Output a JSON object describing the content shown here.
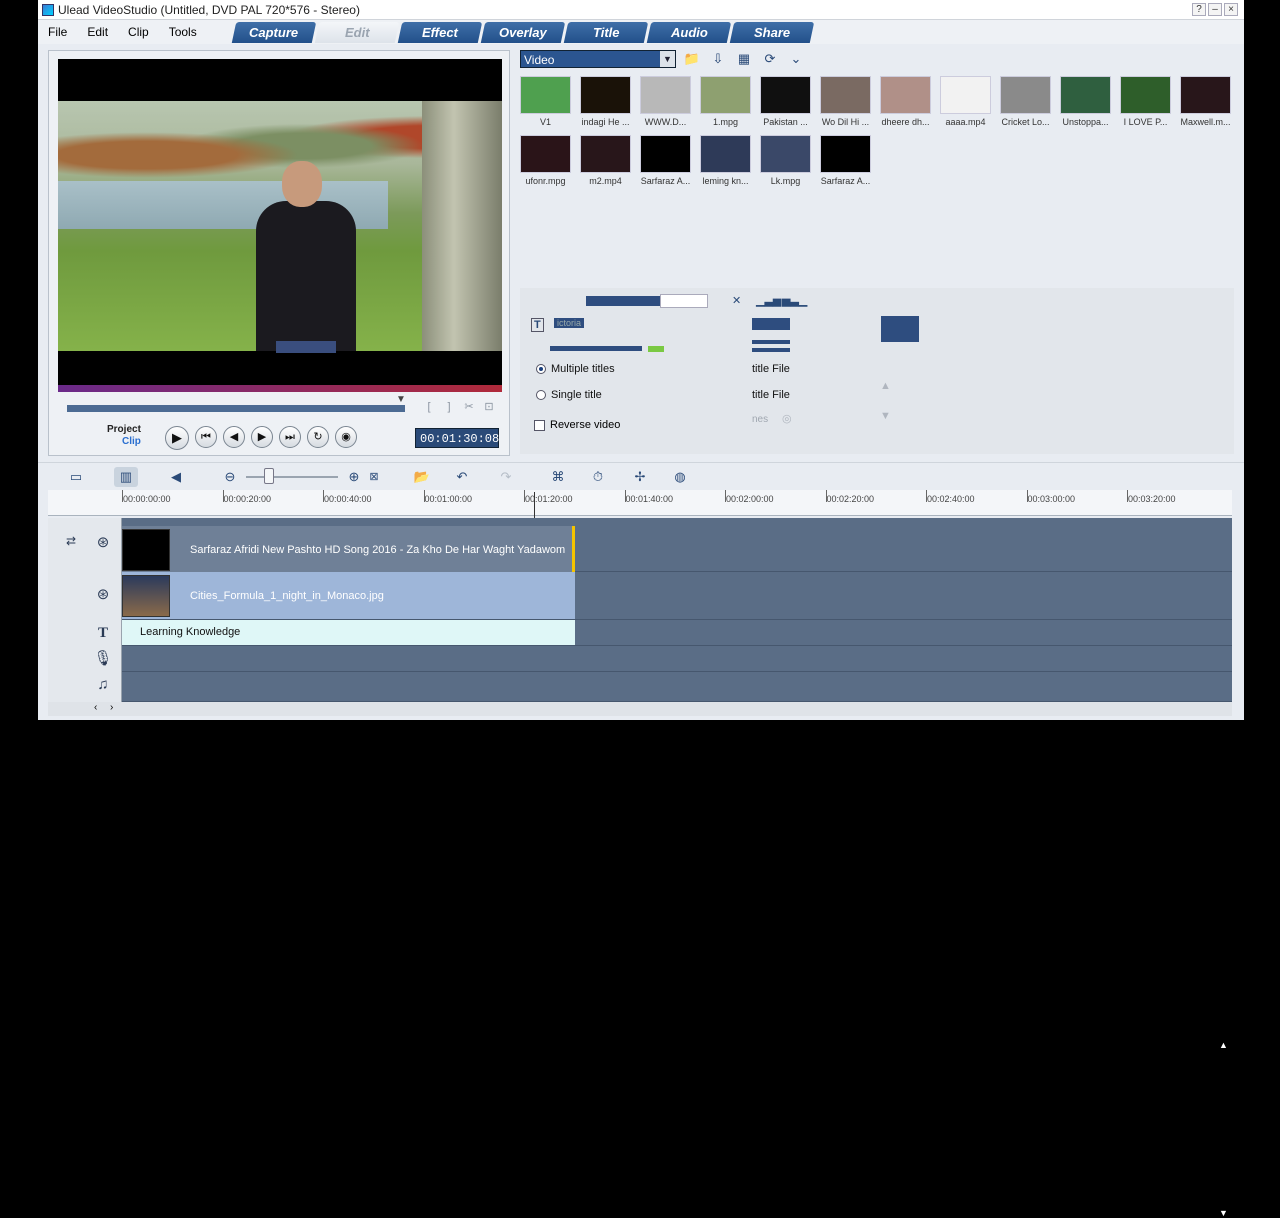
{
  "window": {
    "title": "Ulead VideoStudio (Untitled, DVD PAL 720*576 - Stereo)",
    "buttons": [
      "?",
      "–",
      "×"
    ]
  },
  "menu": [
    "File",
    "Edit",
    "Clip",
    "Tools"
  ],
  "tabs": [
    "Capture",
    "Edit",
    "Effect",
    "Overlay",
    "Title",
    "Audio",
    "Share"
  ],
  "active_tab": "Edit",
  "preview": {
    "mode_project": "Project",
    "mode_clip": "Clip",
    "timecode": "00:01:30:08",
    "controls": [
      "play",
      "home",
      "prev",
      "next",
      "end",
      "repeat",
      "volume"
    ],
    "subtitle_text": "Sarfaraz Afridi"
  },
  "library": {
    "category": "Video",
    "thumbnails": [
      {
        "label": "V1",
        "color": "#4fa04f"
      },
      {
        "label": "indagi He ...",
        "color": "#1a1208"
      },
      {
        "label": "WWW.D...",
        "color": "#b8b8b8"
      },
      {
        "label": "1.mpg",
        "color": "#8ea070"
      },
      {
        "label": "Pakistan ...",
        "color": "#101010"
      },
      {
        "label": "Wo Dil Hi ...",
        "color": "#7a6a62"
      },
      {
        "label": "dheere dh...",
        "color": "#b09088"
      },
      {
        "label": "aaaa.mp4",
        "color": "#f2f2f2"
      },
      {
        "label": "Cricket Lo...",
        "color": "#8a8a8a"
      },
      {
        "label": "Unstoppa...",
        "color": "#2f5f3f"
      },
      {
        "label": "I LOVE P...",
        "color": "#2e5e2a"
      },
      {
        "label": "Maxwell.m...",
        "color": "#28161a"
      },
      {
        "label": "ufonr.mpg",
        "color": "#2a1418"
      },
      {
        "label": "m2.mp4",
        "color": "#28161a"
      },
      {
        "label": "Sarfaraz A...",
        "color": "#000000"
      },
      {
        "label": "leming kn...",
        "color": "#2e3a58"
      },
      {
        "label": "Lk.mpg",
        "color": "#3a4868"
      },
      {
        "label": "Sarfaraz A...",
        "color": "#000000"
      }
    ]
  },
  "options": {
    "multiple_titles": "Multiple titles",
    "single_title": "Single title",
    "reverse_video": "Reverse video",
    "title_file_1": "title File",
    "title_file_2": "title File",
    "lines": "nes",
    "clip_name": "ictoria"
  },
  "timeline": {
    "ruler": [
      "00:00:00:00",
      "00:00:20:00",
      "00:00:40:00",
      "00:01:00:00",
      "00:01:20:00",
      "00:01:40:00",
      "00:02:00:00",
      "00:02:20:00",
      "00:02:40:00",
      "00:03:00:00",
      "00:03:20:00"
    ],
    "video_clip": "Sarfaraz Afridi New Pashto HD Song 2016 - Za Kho De Har Waght Yadawom",
    "overlay_clip": "Cities_Formula_1_night_in_Monaco.jpg",
    "title_clip": "Learning Knowledge"
  }
}
